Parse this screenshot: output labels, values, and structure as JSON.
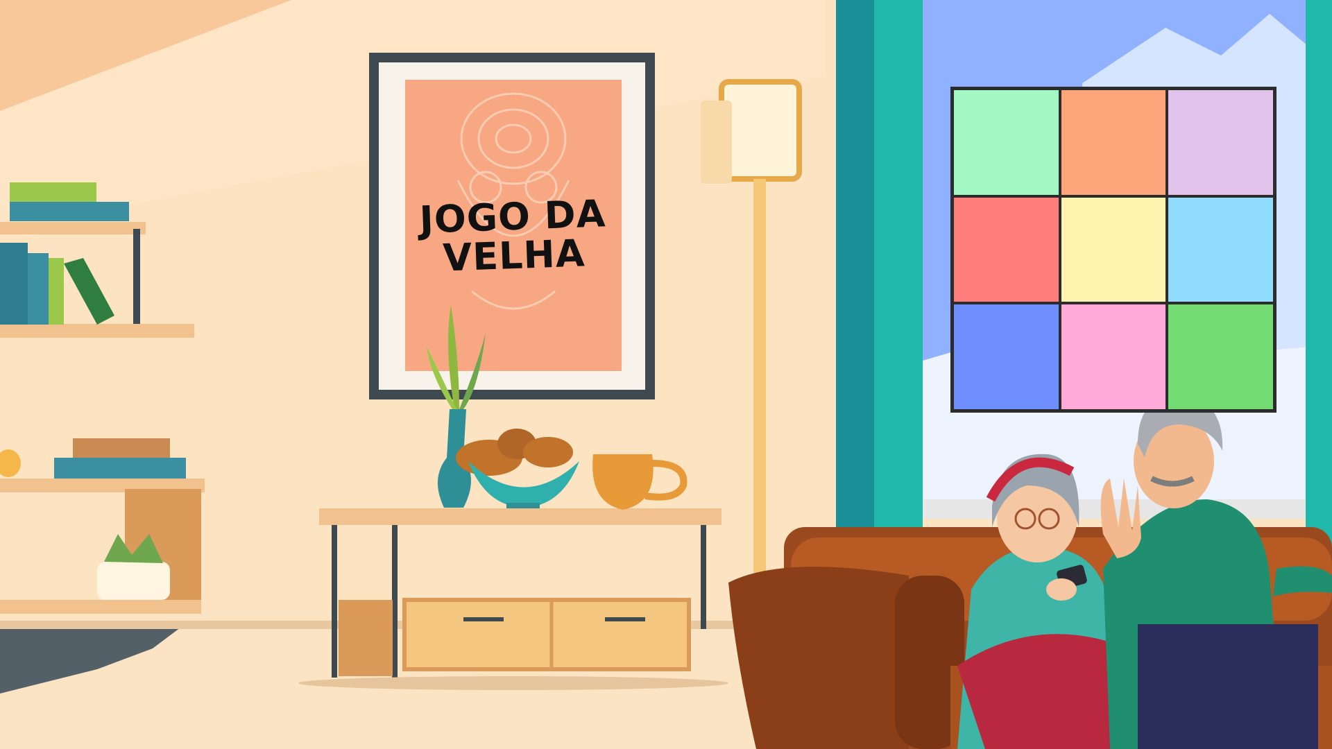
{
  "poster": {
    "title": "JOGO DA VELHA"
  },
  "board": {
    "cells": [
      {
        "color": "#a2f7c3",
        "mark": ""
      },
      {
        "color": "#fda57a",
        "mark": ""
      },
      {
        "color": "#e2c3ec",
        "mark": ""
      },
      {
        "color": "#ff7e7b",
        "mark": ""
      },
      {
        "color": "#fff3b0",
        "mark": ""
      },
      {
        "color": "#8fdcff",
        "mark": ""
      },
      {
        "color": "#6f8eff",
        "mark": ""
      },
      {
        "color": "#ffaad9",
        "mark": ""
      },
      {
        "color": "#72dc72",
        "mark": ""
      }
    ]
  },
  "colors": {
    "wall": "#fce4c2",
    "curtain": "#1fb8ab",
    "sky": "#8fb1ff",
    "sofa": "#9b4a1f"
  }
}
